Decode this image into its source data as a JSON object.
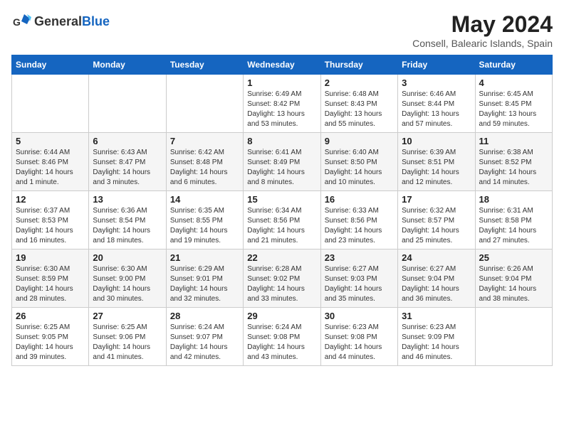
{
  "header": {
    "logo": {
      "general": "General",
      "blue": "Blue"
    },
    "title": "May 2024",
    "subtitle": "Consell, Balearic Islands, Spain"
  },
  "calendar": {
    "headers": [
      "Sunday",
      "Monday",
      "Tuesday",
      "Wednesday",
      "Thursday",
      "Friday",
      "Saturday"
    ],
    "weeks": [
      [
        {
          "day": "",
          "info": ""
        },
        {
          "day": "",
          "info": ""
        },
        {
          "day": "",
          "info": ""
        },
        {
          "day": "1",
          "info": "Sunrise: 6:49 AM\nSunset: 8:42 PM\nDaylight: 13 hours and 53 minutes."
        },
        {
          "day": "2",
          "info": "Sunrise: 6:48 AM\nSunset: 8:43 PM\nDaylight: 13 hours and 55 minutes."
        },
        {
          "day": "3",
          "info": "Sunrise: 6:46 AM\nSunset: 8:44 PM\nDaylight: 13 hours and 57 minutes."
        },
        {
          "day": "4",
          "info": "Sunrise: 6:45 AM\nSunset: 8:45 PM\nDaylight: 13 hours and 59 minutes."
        }
      ],
      [
        {
          "day": "5",
          "info": "Sunrise: 6:44 AM\nSunset: 8:46 PM\nDaylight: 14 hours and 1 minute."
        },
        {
          "day": "6",
          "info": "Sunrise: 6:43 AM\nSunset: 8:47 PM\nDaylight: 14 hours and 3 minutes."
        },
        {
          "day": "7",
          "info": "Sunrise: 6:42 AM\nSunset: 8:48 PM\nDaylight: 14 hours and 6 minutes."
        },
        {
          "day": "8",
          "info": "Sunrise: 6:41 AM\nSunset: 8:49 PM\nDaylight: 14 hours and 8 minutes."
        },
        {
          "day": "9",
          "info": "Sunrise: 6:40 AM\nSunset: 8:50 PM\nDaylight: 14 hours and 10 minutes."
        },
        {
          "day": "10",
          "info": "Sunrise: 6:39 AM\nSunset: 8:51 PM\nDaylight: 14 hours and 12 minutes."
        },
        {
          "day": "11",
          "info": "Sunrise: 6:38 AM\nSunset: 8:52 PM\nDaylight: 14 hours and 14 minutes."
        }
      ],
      [
        {
          "day": "12",
          "info": "Sunrise: 6:37 AM\nSunset: 8:53 PM\nDaylight: 14 hours and 16 minutes."
        },
        {
          "day": "13",
          "info": "Sunrise: 6:36 AM\nSunset: 8:54 PM\nDaylight: 14 hours and 18 minutes."
        },
        {
          "day": "14",
          "info": "Sunrise: 6:35 AM\nSunset: 8:55 PM\nDaylight: 14 hours and 19 minutes."
        },
        {
          "day": "15",
          "info": "Sunrise: 6:34 AM\nSunset: 8:56 PM\nDaylight: 14 hours and 21 minutes."
        },
        {
          "day": "16",
          "info": "Sunrise: 6:33 AM\nSunset: 8:56 PM\nDaylight: 14 hours and 23 minutes."
        },
        {
          "day": "17",
          "info": "Sunrise: 6:32 AM\nSunset: 8:57 PM\nDaylight: 14 hours and 25 minutes."
        },
        {
          "day": "18",
          "info": "Sunrise: 6:31 AM\nSunset: 8:58 PM\nDaylight: 14 hours and 27 minutes."
        }
      ],
      [
        {
          "day": "19",
          "info": "Sunrise: 6:30 AM\nSunset: 8:59 PM\nDaylight: 14 hours and 28 minutes."
        },
        {
          "day": "20",
          "info": "Sunrise: 6:30 AM\nSunset: 9:00 PM\nDaylight: 14 hours and 30 minutes."
        },
        {
          "day": "21",
          "info": "Sunrise: 6:29 AM\nSunset: 9:01 PM\nDaylight: 14 hours and 32 minutes."
        },
        {
          "day": "22",
          "info": "Sunrise: 6:28 AM\nSunset: 9:02 PM\nDaylight: 14 hours and 33 minutes."
        },
        {
          "day": "23",
          "info": "Sunrise: 6:27 AM\nSunset: 9:03 PM\nDaylight: 14 hours and 35 minutes."
        },
        {
          "day": "24",
          "info": "Sunrise: 6:27 AM\nSunset: 9:04 PM\nDaylight: 14 hours and 36 minutes."
        },
        {
          "day": "25",
          "info": "Sunrise: 6:26 AM\nSunset: 9:04 PM\nDaylight: 14 hours and 38 minutes."
        }
      ],
      [
        {
          "day": "26",
          "info": "Sunrise: 6:25 AM\nSunset: 9:05 PM\nDaylight: 14 hours and 39 minutes."
        },
        {
          "day": "27",
          "info": "Sunrise: 6:25 AM\nSunset: 9:06 PM\nDaylight: 14 hours and 41 minutes."
        },
        {
          "day": "28",
          "info": "Sunrise: 6:24 AM\nSunset: 9:07 PM\nDaylight: 14 hours and 42 minutes."
        },
        {
          "day": "29",
          "info": "Sunrise: 6:24 AM\nSunset: 9:08 PM\nDaylight: 14 hours and 43 minutes."
        },
        {
          "day": "30",
          "info": "Sunrise: 6:23 AM\nSunset: 9:08 PM\nDaylight: 14 hours and 44 minutes."
        },
        {
          "day": "31",
          "info": "Sunrise: 6:23 AM\nSunset: 9:09 PM\nDaylight: 14 hours and 46 minutes."
        },
        {
          "day": "",
          "info": ""
        }
      ]
    ]
  }
}
